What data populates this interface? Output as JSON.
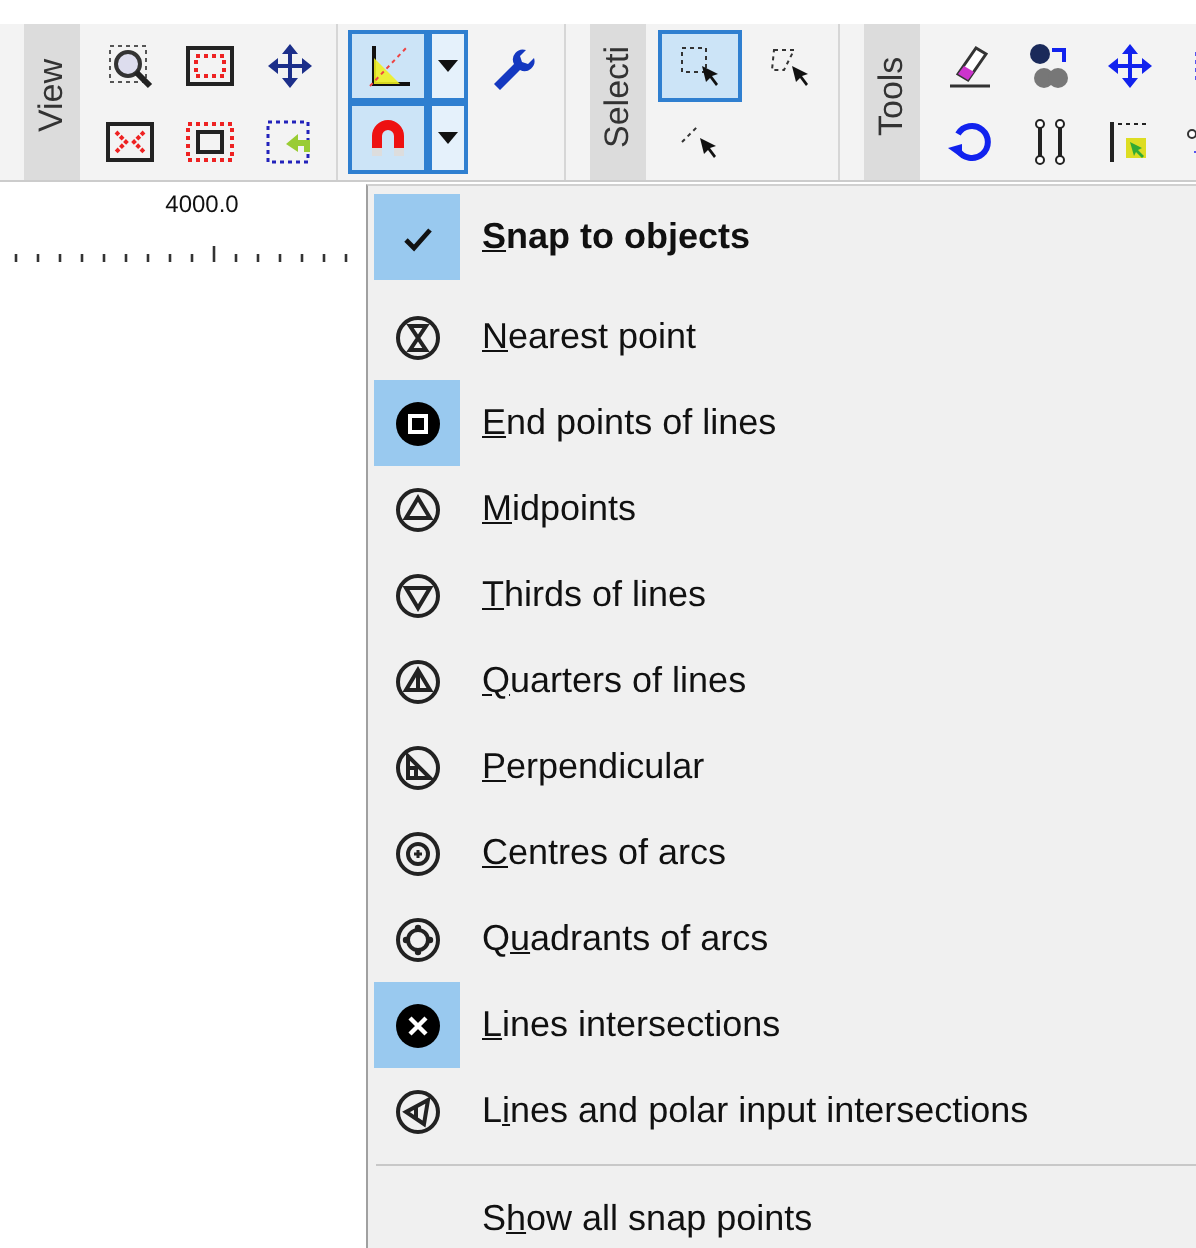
{
  "toolbar": {
    "groups": [
      {
        "label": "View",
        "buttons": [
          {
            "selected": false
          },
          {
            "selected": false
          },
          {
            "selected": false
          },
          {
            "selected": false
          },
          {
            "selected": false
          },
          {
            "selected": false
          }
        ]
      },
      {
        "buttons": [
          {
            "selected": true
          },
          {
            "selected": false
          },
          {
            "selected": true
          },
          {
            "selected": false
          }
        ]
      },
      {
        "label": "Selecti",
        "buttons": [
          {
            "selected": true
          },
          {
            "selected": false
          },
          {
            "selected": false
          }
        ]
      },
      {
        "label": "Tools",
        "buttons": [
          {
            "selected": false
          },
          {
            "selected": false
          },
          {
            "selected": false
          },
          {
            "selected": false
          },
          {
            "selected": false
          },
          {
            "selected": false
          },
          {
            "selected": false
          },
          {
            "selected": false
          }
        ]
      }
    ]
  },
  "ruler": {
    "label": "4000.0"
  },
  "snap_menu": {
    "items": [
      {
        "kind": "check",
        "label": {
          "key": "S",
          "after": "nap to objects"
        },
        "checked": true
      },
      {
        "kind": "snap",
        "label": {
          "key": "N",
          "after": "earest point"
        },
        "checked": false
      },
      {
        "kind": "snap",
        "label": {
          "key": "E",
          "after": "nd points of lines"
        },
        "checked": true
      },
      {
        "kind": "snap",
        "label": {
          "key": "M",
          "after": "idpoints"
        },
        "checked": false
      },
      {
        "kind": "snap",
        "label": {
          "key": "T",
          "after": "hirds of lines"
        },
        "checked": false
      },
      {
        "kind": "snap",
        "label": {
          "key": "Q",
          "after": "uarters of lines"
        },
        "checked": false
      },
      {
        "kind": "snap",
        "label": {
          "key": "P",
          "after": "erpendicular"
        },
        "checked": false
      },
      {
        "kind": "snap",
        "label": {
          "key": "C",
          "after": "entres of arcs"
        },
        "checked": false
      },
      {
        "kind": "snap",
        "label": {
          "before": "Q",
          "key": "u",
          "after": "adrants of arcs"
        },
        "checked": false
      },
      {
        "kind": "snap",
        "label": {
          "key": "L",
          "after": "ines intersections"
        },
        "checked": true
      },
      {
        "kind": "snap",
        "label": {
          "before": "L",
          "key": "i",
          "after": "nes and polar input intersections"
        },
        "checked": false
      },
      {
        "kind": "separator"
      },
      {
        "kind": "command",
        "label": {
          "before": "S",
          "key": "h",
          "after": "ow all snap points"
        }
      }
    ]
  }
}
